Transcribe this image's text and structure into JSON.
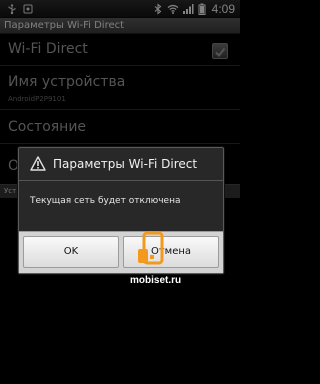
{
  "status_bar": {
    "time": "4:09",
    "icons": [
      "usb-icon",
      "notification-icon",
      "bluetooth-icon",
      "wifi-icon",
      "signal-icon",
      "battery-icon"
    ]
  },
  "title_bar": {
    "title": "Параметры Wi-Fi Direct"
  },
  "settings": {
    "wifi_direct": {
      "label": "Wi-Fi Direct",
      "checked": true
    },
    "device_name": {
      "label": "Имя устройства",
      "value": "AndroidP2P9101"
    },
    "status": {
      "label": "Состояние"
    },
    "partial_item": {
      "label": "О"
    },
    "section": {
      "label": "Уст"
    }
  },
  "dialog": {
    "icon": "alert-icon",
    "title": "Параметры Wi-Fi Direct",
    "message": "Текущая сеть будет отключена",
    "ok_label": "OK",
    "cancel_label": "Отмена"
  },
  "watermark": {
    "text": "mobiset.ru",
    "accent": "#f39a1e"
  }
}
